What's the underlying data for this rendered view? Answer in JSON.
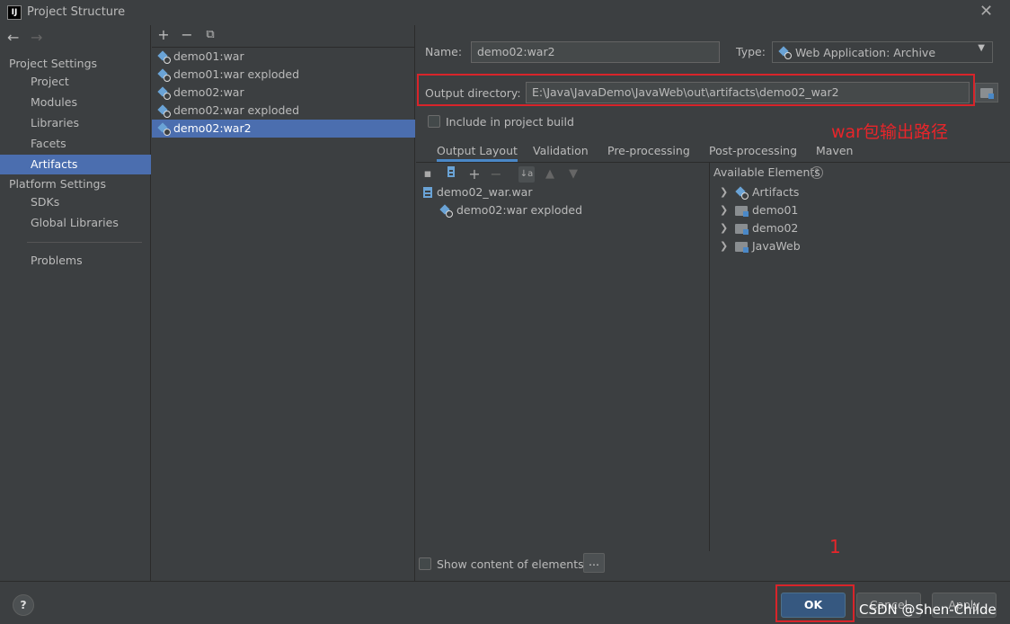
{
  "window": {
    "title": "Project Structure",
    "logo": "IJ",
    "close": "✕"
  },
  "nav": {
    "back_icon": "arrow-left-icon",
    "forward_icon": "arrow-right-icon",
    "project_settings_label": "Project Settings",
    "project_settings_items": [
      "Project",
      "Modules",
      "Libraries",
      "Facets",
      "Artifacts"
    ],
    "platform_settings_label": "Platform Settings",
    "platform_settings_items": [
      "SDKs",
      "Global Libraries"
    ],
    "problems_label": "Problems",
    "selected": "Artifacts"
  },
  "artifact_toolbar": {
    "add": "+",
    "remove": "−",
    "copy": "⧉"
  },
  "artifacts": [
    "demo01:war",
    "demo01:war exploded",
    "demo02:war",
    "demo02:war exploded",
    "demo02:war2"
  ],
  "selected_artifact": "demo02:war2",
  "form": {
    "name_label": "Name:",
    "name_value": "demo02:war2",
    "type_label": "Type:",
    "type_value": "Web Application: Archive",
    "output_label": "Output directory:",
    "output_value": "E:\\Java\\JavaDemo\\JavaWeb\\out\\artifacts\\demo02_war2",
    "include_label": "Include in project build",
    "include_checked": false
  },
  "tabs": [
    "Output Layout",
    "Validation",
    "Pre-processing",
    "Post-processing",
    "Maven"
  ],
  "active_tab": "Output Layout",
  "layout_tree": {
    "root": "demo02_war.war",
    "children": [
      "demo02:war exploded"
    ]
  },
  "available": {
    "label": "Available Elements",
    "help": "?",
    "items": [
      "Artifacts",
      "demo01",
      "demo02",
      "JavaWeb"
    ]
  },
  "show_content_label": "Show content of elements",
  "more_button": "...",
  "annotations": {
    "output_note": "war包输出路径",
    "ok_note": "1",
    "color": "#d8242a"
  },
  "buttons": {
    "help": "?",
    "ok": "OK",
    "cancel": "Cancel",
    "apply": "Apply"
  },
  "watermark": "CSDN @Shen-Childe"
}
